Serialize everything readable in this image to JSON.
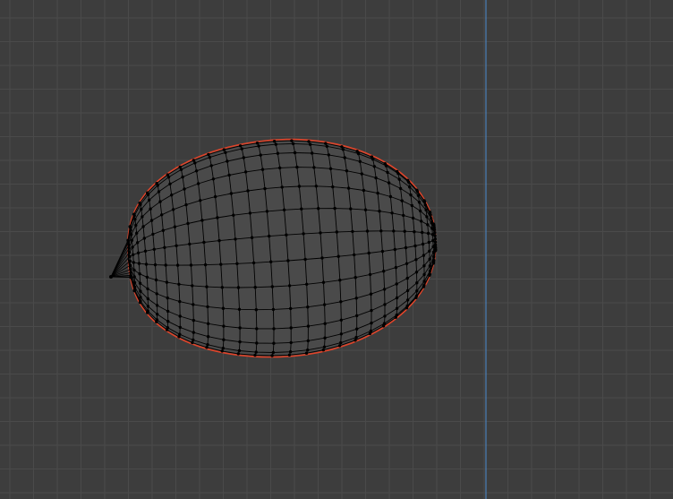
{
  "viewport": {
    "mode": "edit-mode",
    "background_color": "#3d3d3d",
    "grid_minor_color": "#4a4a4a",
    "grid_major_color": "#474747",
    "axis_color": "#4a7fb8"
  },
  "mesh": {
    "shape": "uv-sphere (deformed)",
    "fill_color": "#4a4a4a",
    "edge_color": "#000000",
    "vertex_color": "#000000",
    "boundary_highlight_color": "#e0442a",
    "rings": 13,
    "segments": 28
  }
}
